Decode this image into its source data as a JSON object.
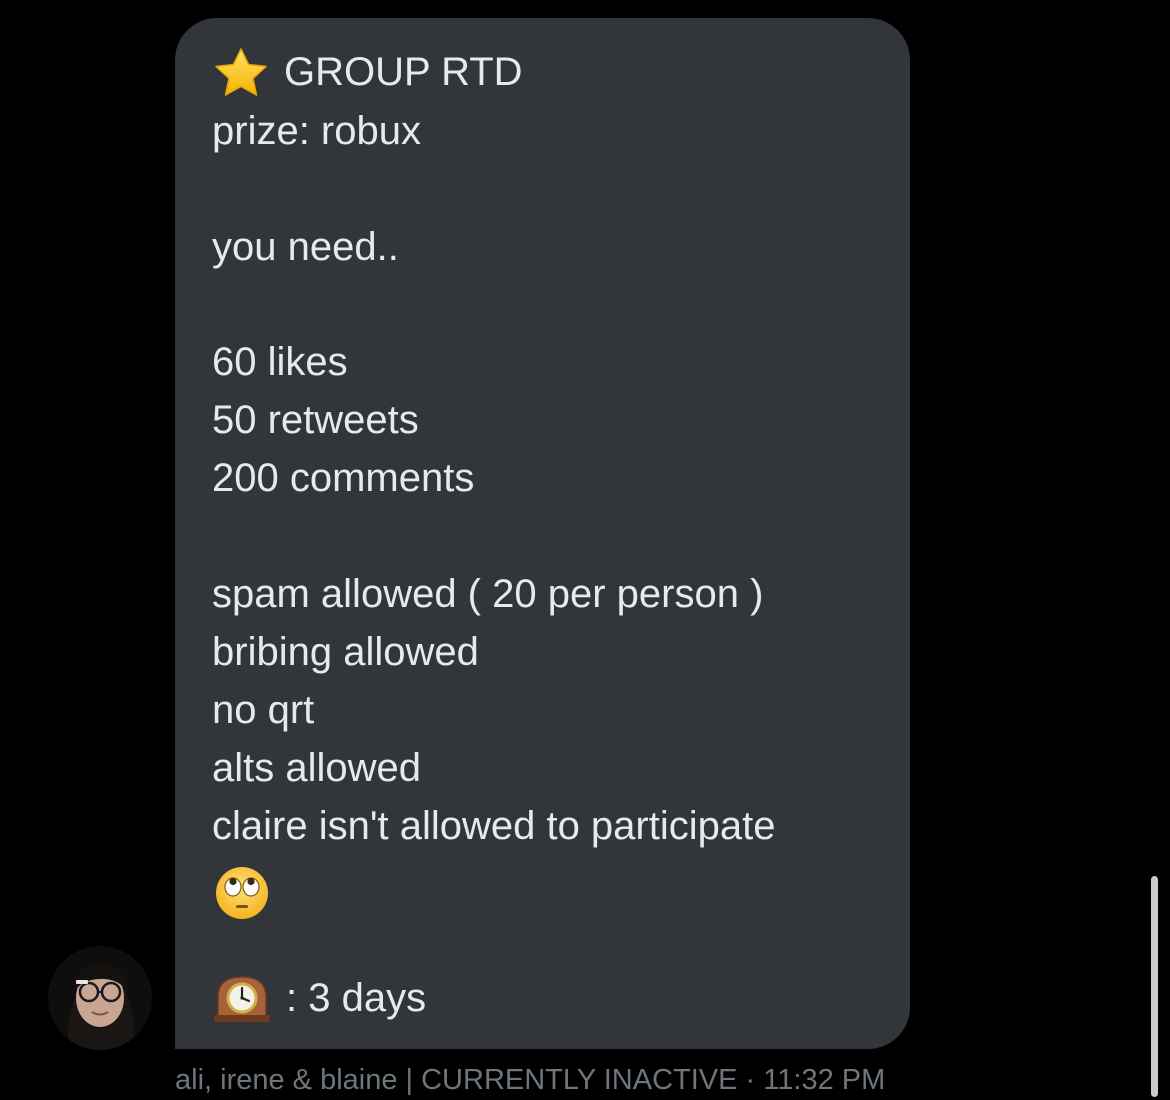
{
  "message": {
    "star_emoji": "star-icon",
    "title": "GROUP RTD",
    "lines": {
      "prize": "prize: robux",
      "need": "you need..",
      "likes": "60 likes",
      "retweets": "50 retweets",
      "comments": "200 comments",
      "spam": "spam allowed ( 20 per person )",
      "bribing": "bribing allowed",
      "no_qrt": "no qrt",
      "alts": "alts allowed",
      "claire": "claire isn't allowed to participate"
    },
    "eye_roll_emoji": "eye-roll-face-icon",
    "clock_emoji": "mantelpiece-clock-icon",
    "duration": ": 3 days"
  },
  "footer": {
    "sender_info": "ali, irene & blaine | CURRENTLY INACTIVE",
    "separator": "·",
    "time": "11:32 PM"
  },
  "colors": {
    "background": "#000000",
    "bubble": "#323539",
    "text": "#e7e9ea",
    "meta": "#6f767b"
  }
}
